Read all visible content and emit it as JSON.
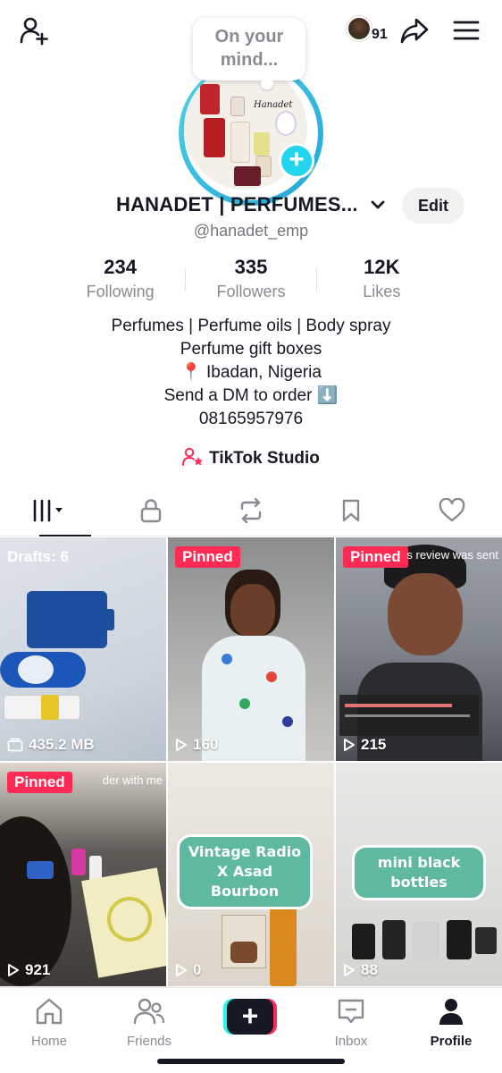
{
  "topbar": {
    "add_friend_icon": "add-user-icon",
    "viewer_count": "91",
    "share_icon": "share-arrow-icon",
    "menu_icon": "hamburger-menu-icon"
  },
  "avatar": {
    "bubble_text": "On your mind...",
    "plus": "+",
    "ring_color": "#22a6d8",
    "brand_text": "Hanadet"
  },
  "profile": {
    "display_name": "HANADET | PERFUMES...",
    "username": "@hanadet_emp",
    "edit_label": "Edit"
  },
  "stats": [
    {
      "value": "234",
      "label": "Following"
    },
    {
      "value": "335",
      "label": "Followers"
    },
    {
      "value": "12K",
      "label": "Likes"
    }
  ],
  "bio": {
    "line1": "Perfumes | Perfume oils | Body spray",
    "line2": "Perfume gift boxes",
    "line3": "📍 Ibadan, Nigeria",
    "line4": "Send a DM to order ⬇️",
    "line5": "08165957976"
  },
  "studio": {
    "label": "TikTok Studio"
  },
  "tabs": [
    {
      "icon": "videos-grid-icon",
      "active": true
    },
    {
      "icon": "lock-icon"
    },
    {
      "icon": "repost-icon"
    },
    {
      "icon": "bookmark-icon"
    },
    {
      "icon": "heart-icon"
    }
  ],
  "grid": {
    "pinned_label": "Pinned",
    "drafts_label": "Drafts: 6",
    "drafts_size": "435.2 MB",
    "tiles": [
      {
        "views": "160"
      },
      {
        "views": "215",
        "overlay": "s review was sent"
      },
      {
        "views": "921",
        "overlay": "der with me"
      },
      {
        "views": "0",
        "caption": "Vintage Radio X Asad Bourbon"
      },
      {
        "views": "88",
        "caption": "mini black bottles"
      }
    ]
  },
  "nav": {
    "home": "Home",
    "friends": "Friends",
    "create": "+",
    "inbox": "Inbox",
    "profile": "Profile"
  },
  "colors": {
    "pinned": "#fe2c55",
    "create_cyan": "#25f4ee",
    "create_red": "#fe2c55",
    "studio_icon": "#fe2c55"
  }
}
